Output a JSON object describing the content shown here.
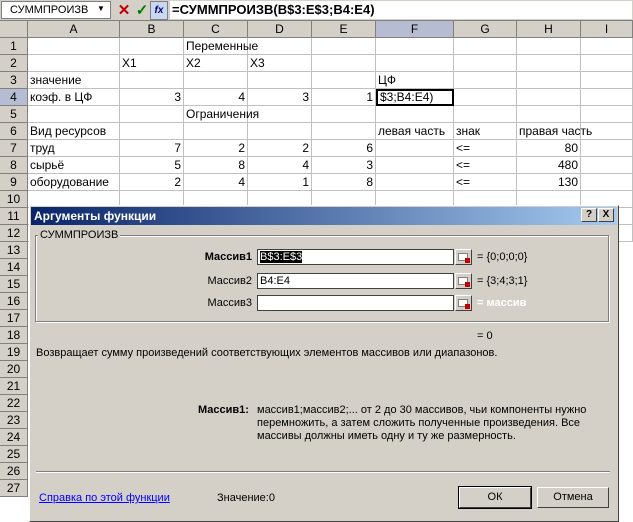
{
  "formula_bar": {
    "name_box": "СУММПРОИЗВ",
    "formula": "=СУММПРОИЗВ(B$3:E$3;B4:E4)"
  },
  "columns": [
    "A",
    "B",
    "C",
    "D",
    "E",
    "F",
    "G",
    "H",
    "I"
  ],
  "rows": [
    "1",
    "2",
    "3",
    "4",
    "5",
    "6",
    "7",
    "8",
    "9",
    "10",
    "11",
    "12",
    "13",
    "14",
    "15",
    "16",
    "17",
    "18",
    "19",
    "20",
    "21",
    "22",
    "23",
    "24",
    "25",
    "26",
    "27"
  ],
  "sheet": {
    "r1_c": "Переменные",
    "r2_b": "X1",
    "r2_c": "X2",
    "r2_d": "X3",
    "r3_a": "значение",
    "r3_f": "ЦФ",
    "r4_a": "коэф. в ЦФ",
    "r4_b": "3",
    "r4_c": "4",
    "r4_d": "3",
    "r4_e": "1",
    "r4_f": "$3;B4:E4)",
    "r5_c": "Ограничения",
    "r6_a": "Вид ресурсов",
    "r6_f": "левая часть",
    "r6_g": "знак",
    "r6_h": "правая часть",
    "r7_a": "труд",
    "r7_b": "7",
    "r7_c": "2",
    "r7_d": "2",
    "r7_e": "6",
    "r7_g": "<=",
    "r7_h": "80",
    "r8_a": "сырьё",
    "r8_b": "5",
    "r8_c": "8",
    "r8_d": "4",
    "r8_e": "3",
    "r8_g": "<=",
    "r8_h": "480",
    "r9_a": "оборудование",
    "r9_b": "2",
    "r9_c": "4",
    "r9_d": "1",
    "r9_e": "8",
    "r9_g": "<=",
    "r9_h": "130"
  },
  "dialog": {
    "title": "Аргументы функции",
    "help_btn": "?",
    "close_btn": "X",
    "group": "СУММПРОИЗВ",
    "args": [
      {
        "label": "Массив1",
        "value": "B$3:E$3",
        "result": "= {0;0;0;0}"
      },
      {
        "label": "Массив2",
        "value": "B4:E4",
        "result": "= {3;4;3;1}"
      },
      {
        "label": "Массив3",
        "value": "",
        "result": "= массив"
      }
    ],
    "total": "= 0",
    "description": "Возвращает сумму произведений соответствующих элементов массивов или диапазонов.",
    "arg_name": "Массив1:",
    "arg_text": "массив1;массив2;... от 2 до 30 массивов, чьи компоненты нужно перемножить, а затем сложить полученные произведения. Все массивы должны иметь одну и ту же размерность.",
    "help_link": "Справка по этой функции",
    "value_label": "Значение:0",
    "ok": "ОК",
    "cancel": "Отмена"
  }
}
